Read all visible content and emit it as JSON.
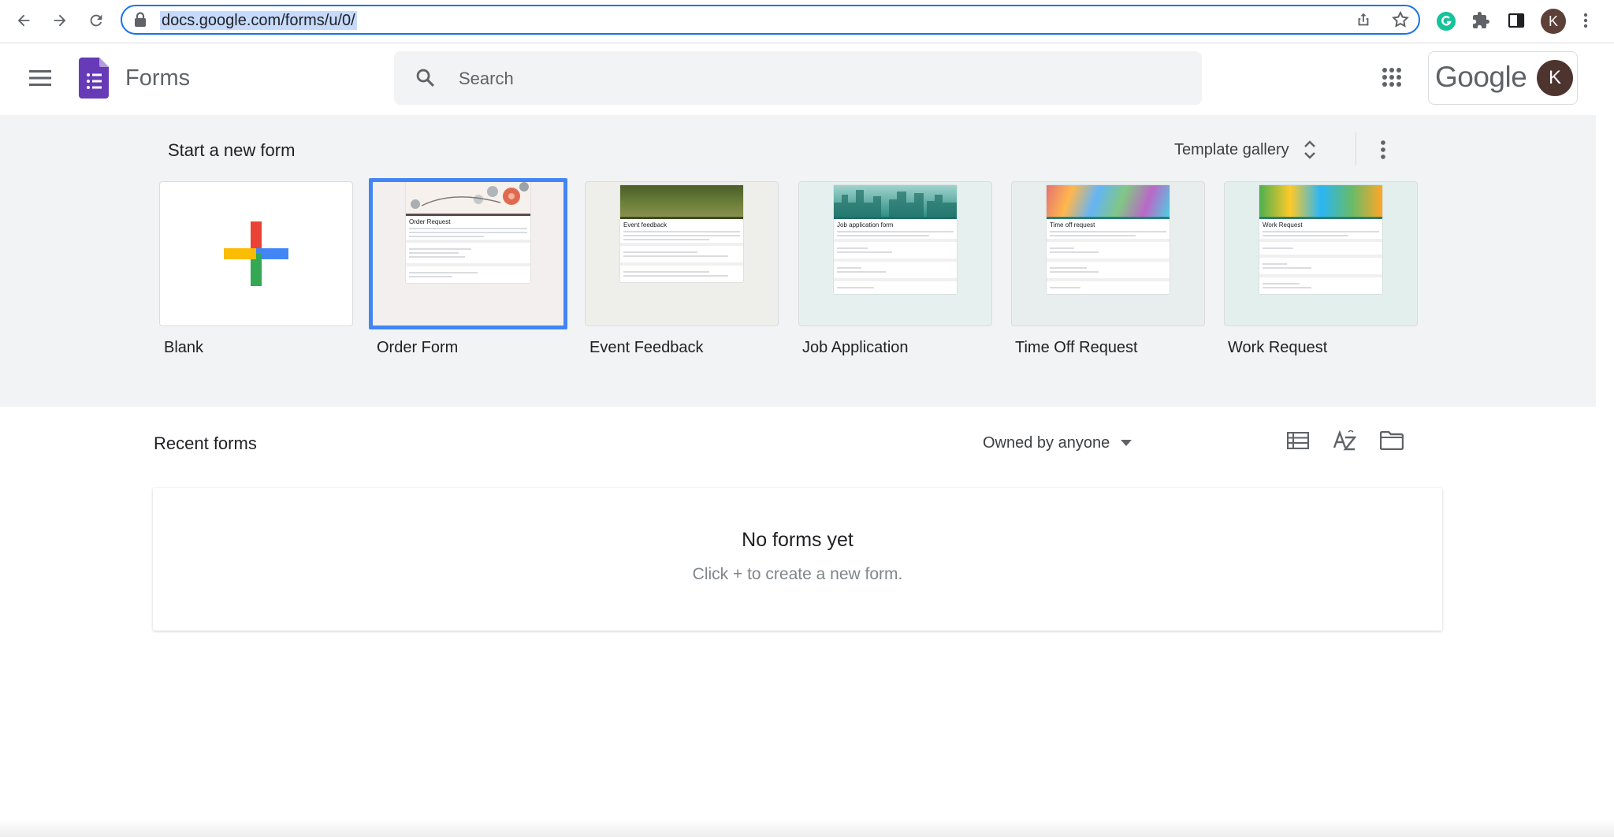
{
  "browser": {
    "url": "docs.google.com/forms/u/0/",
    "profile_initial": "K",
    "icons": [
      "back-arrow-icon",
      "forward-arrow-icon",
      "reload-icon",
      "lock-icon",
      "share-icon",
      "star-icon",
      "grammarly-icon",
      "extensions-puzzle-icon",
      "side-panel-icon",
      "chrome-menu-icon"
    ]
  },
  "header": {
    "app_name": "Forms",
    "search_placeholder": "Search",
    "google_wordmark": "Google",
    "account_initial": "K",
    "icons": [
      "hamburger-menu-icon",
      "forms-logo-icon",
      "search-icon",
      "apps-grid-icon"
    ]
  },
  "templates": {
    "section_title": "Start a new form",
    "gallery_label": "Template gallery",
    "items": [
      {
        "label": "Blank"
      },
      {
        "label": "Order Form",
        "selected": true,
        "thumb_title": "Order Request"
      },
      {
        "label": "Event Feedback",
        "thumb_title": "Event feedback"
      },
      {
        "label": "Job Application",
        "thumb_title": "Job application form"
      },
      {
        "label": "Time Off Request",
        "thumb_title": "Time off request"
      },
      {
        "label": "Work Request",
        "thumb_title": "Work Request"
      }
    ]
  },
  "recent": {
    "title": "Recent forms",
    "owner_filter": "Owned by anyone",
    "empty_title": "No forms yet",
    "empty_subtitle": "Click + to create a new form.",
    "icons": [
      "list-view-icon",
      "sort-az-icon",
      "folder-icon"
    ]
  },
  "colors": {
    "accent_blue": "#1a73e8",
    "forms_purple": "#673ab7",
    "template_bg": "#f1f3f4",
    "selected_border": "#4285f4"
  }
}
